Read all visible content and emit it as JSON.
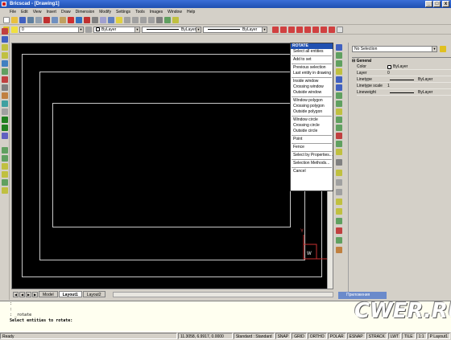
{
  "window": {
    "title": "Bricscad - [Drawing1]",
    "min": "_",
    "max": "□",
    "close": "x"
  },
  "menubar": [
    "File",
    "Edit",
    "View",
    "Insert",
    "Draw",
    "Dimension",
    "Modify",
    "Settings",
    "Tools",
    "Images",
    "Window",
    "Help"
  ],
  "layer_bar": {
    "layer_value": "0",
    "color_value": "ByLayer",
    "linetype_value": "ByLayer",
    "lineweight_value": "ByLayer"
  },
  "context_menu": {
    "title": "ROTATE",
    "groups": [
      [
        "Select all entities"
      ],
      [
        "Add to set"
      ],
      [
        "Previous selection",
        "Last entity in drawing"
      ],
      [
        "Inside window",
        "Crossing window",
        "Outside window"
      ],
      [
        "Window polygon",
        "Crossing polygon",
        "Outside polygon"
      ],
      [
        "Window circle",
        "Crossing circle",
        "Outside circle"
      ],
      [
        "Point"
      ],
      [
        "Fence"
      ],
      [
        "Select by Properties..."
      ],
      [
        "Selection Methods..."
      ],
      [
        "Cancel"
      ]
    ]
  },
  "layout_tabs": {
    "model": "Model",
    "layout1": "Layout1",
    "layout2": "Layout2"
  },
  "ucs": {
    "y_label": "Y",
    "w_label": "W",
    "x_label": "X"
  },
  "properties": {
    "selection": "No Selection",
    "section": "General",
    "rows": [
      {
        "k": "Color",
        "v": "ByLayer"
      },
      {
        "k": "Layer",
        "v": "0"
      },
      {
        "k": "Linetype",
        "v": "ByLayer"
      },
      {
        "k": "Linetype scale",
        "v": "1"
      },
      {
        "k": "Lineweight",
        "v": "ByLayer"
      }
    ]
  },
  "properties_task": "Приложения",
  "command": {
    "lines": [
      ":",
      ":",
      ": _rotate"
    ],
    "prompt": "Select entities to rotate:"
  },
  "status": {
    "ready": "Ready",
    "coords": "11.3058, 6.9917, 0.0000",
    "style": "Standard : Standard",
    "toggles": [
      "SNAP",
      "GRID",
      "ORTHO",
      "POLAR",
      "ESNAP",
      "STRACK",
      "LWT",
      "TILE",
      "1:1"
    ],
    "layout": "P Layout1"
  },
  "watermark": "CWER.RU"
}
